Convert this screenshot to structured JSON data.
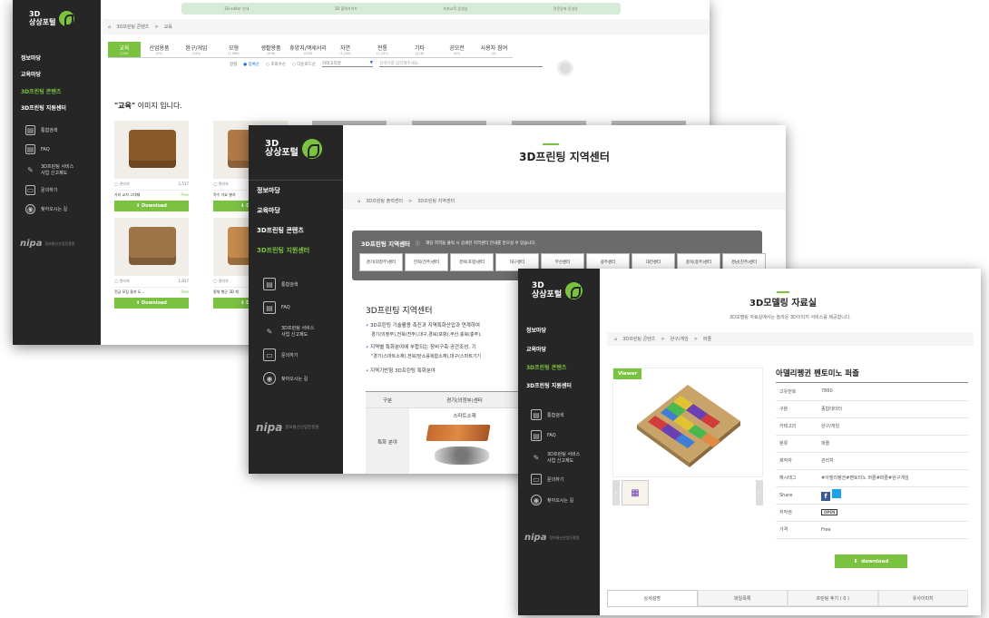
{
  "win1": {
    "top_links": [
      "3D editor 안내",
      "3D 출력가이드",
      "지포교육 동영상",
      "전문강좌 동영상"
    ],
    "logo": {
      "line1": "3D",
      "line2": "상상포털"
    },
    "menu": [
      "정보마당",
      "교육마당",
      "3D프린팅 콘텐츠",
      "3D프린팅 지원센터"
    ],
    "quick": [
      "통합검색",
      "FAQ",
      "3D프린팅 서비스 사업 신고제도",
      "문의하기",
      "찾아오시는 길"
    ],
    "nipa": "nipa",
    "nipa_sub": "정보통신산업진흥원",
    "breadcrumb": [
      "3D프린팅 콘텐츠",
      "교육"
    ],
    "categories": [
      {
        "label": "교육",
        "count": "(246)"
      },
      {
        "label": "산업용품",
        "count": "(95)"
      },
      {
        "label": "완구/게임",
        "count": "(345)"
      },
      {
        "label": "모형",
        "count": "(1,086)"
      },
      {
        "label": "생활용품",
        "count": "(496)"
      },
      {
        "label": "휴양지/액세서리",
        "count": "(236)"
      },
      {
        "label": "자연",
        "count": "(1,246)"
      },
      {
        "label": "전통",
        "count": "(1,233)"
      },
      {
        "label": "기타",
        "count": "(218)"
      },
      {
        "label": "공모전",
        "count": "(60)"
      },
      {
        "label": "사용자 참여",
        "count": "(8)"
      }
    ],
    "sort_label": "정렬",
    "sort_options": [
      "등록순",
      "조회수순",
      "다운로드순"
    ],
    "select_value": "카테고리명",
    "search_placeholder": "검색어를 입력해주세요.",
    "heading_quote": "\"교육\"",
    "heading_rest": " 이미지 입니다.",
    "cards": [
      {
        "author": "관리자",
        "meta": "2,517",
        "title": "가리 교자 고대제",
        "price": "Free",
        "button": "Download"
      },
      {
        "author": "관리자",
        "meta": "",
        "title": "목수 가요 별자",
        "price": "",
        "button": "Down"
      },
      {
        "author": "관리자",
        "meta": "1,817",
        "title": "전금 모집 물자 도...",
        "price": "Free",
        "button": "Download"
      },
      {
        "author": "관리자",
        "meta": "",
        "title": "종체 행군 3D 체",
        "price": "",
        "button": "Down"
      }
    ]
  },
  "win2": {
    "logo": {
      "line1": "3D",
      "line2": "상상포털"
    },
    "menu": [
      "정보마당",
      "교육마당",
      "3D프린팅 콘텐츠",
      "3D프린팅 지원센터"
    ],
    "quick": [
      "통합검색",
      "FAQ",
      "3D프린팅 서비스 사업 신고제도",
      "문의하기",
      "찾아오시는 길"
    ],
    "nipa": "nipa",
    "nipa_sub": "정보통신산업진흥원",
    "title": "3D프린팅 지역센터",
    "breadcrumb": [
      "3D프린팅 출력센터",
      "3D프린팅 지역센터"
    ],
    "panel_title": "3D프린팅 지역센터",
    "panel_note": "해당 지역을 클릭 시 상세한 지역센터 안내를 받으실 수 있습니다.",
    "regions": [
      "경기(의정부)센터",
      "전북(전주)센터",
      "경북(포항)센터",
      "대구센터",
      "부산센터",
      "광주센터",
      "대전센터",
      "충북(충주)센터",
      "경남(진주)센터"
    ],
    "section_title": "3D프린팅 지역센터",
    "bullets": [
      "3D프린팅 기술활용 촉진과 지역특화산업과 연계하여",
      "경기(의정부),전북(전주),대구,경북(포항),부산,충북(충주),",
      "지역별 특화분야에 부합되는 장비구축·공간조성, 기",
      "\"경기(스마트소재),전북(탄소융복합소재),대구(스마트기기",
      "지역기반형 3D프린팅 특화분야"
    ],
    "table_h1": "구분",
    "table_h2": "경기(의정부)센터",
    "table_row_label": "특화 분야",
    "table_cell": "스마트소재"
  },
  "win3": {
    "logo": {
      "line1": "3D",
      "line2": "상상포털"
    },
    "menu": [
      "정보마당",
      "교육마당",
      "3D프린팅 콘텐츠",
      "3D프린팅 지원센터"
    ],
    "quick": [
      "통합검색",
      "FAQ",
      "3D프린팅 서비스 사업 신고제도",
      "문의하기",
      "찾아오시는 길"
    ],
    "nipa": "nipa",
    "nipa_sub": "정보통신산업진흥원",
    "title": "3D모델링 자료실",
    "subtitle": "3D모델링 자료실에서는 놀라운 3D이미지 서비스를 제공합니다.",
    "breadcrumb": [
      "3D프린팅 콘텐츠",
      "완구/게임",
      "퍼즐"
    ],
    "viewer_label": "Viewer",
    "product_title": "아델리펭귄 펜토미노 퍼즐",
    "info": [
      {
        "k": "고유번호",
        "v": "7860"
      },
      {
        "k": "구분",
        "v": "종합데이터"
      },
      {
        "k": "카테고리",
        "v": "완구/게임"
      },
      {
        "k": "분류",
        "v": "퍼즐"
      },
      {
        "k": "제작자",
        "v": "관리자"
      },
      {
        "k": "해시태그",
        "v": "#아델리펭귄#펜토미노 퍼즐#퍼즐#완구게임"
      },
      {
        "k": "Share",
        "v": ""
      },
      {
        "k": "저작권",
        "v": ""
      },
      {
        "k": "가격",
        "v": "Free"
      }
    ],
    "license": "OPEN",
    "download": "download",
    "tabs": [
      "상세설명",
      "파일목록",
      "프린팅 후기 ( 0 )",
      "유사이미지"
    ]
  }
}
